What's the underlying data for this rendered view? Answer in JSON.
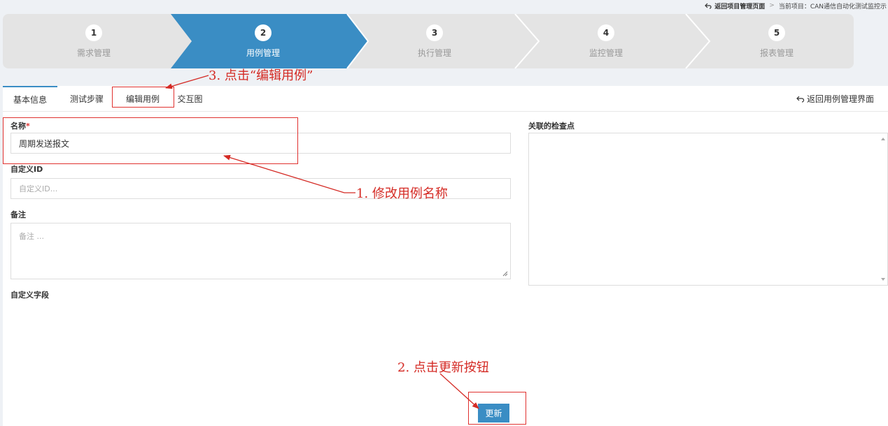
{
  "topbar": {
    "back_label": "返回项目管理页面",
    "separator": ">",
    "project_label": "当前项目：CAN通信自动化测试监控示"
  },
  "wizard": {
    "steps": [
      {
        "num": "1",
        "label": "需求管理",
        "active": false
      },
      {
        "num": "2",
        "label": "用例管理",
        "active": true
      },
      {
        "num": "3",
        "label": "执行管理",
        "active": false
      },
      {
        "num": "4",
        "label": "监控管理",
        "active": false
      },
      {
        "num": "5",
        "label": "报表管理",
        "active": false
      }
    ],
    "active_color": "#3a8dc4",
    "inactive_color": "#e4e4e4"
  },
  "tabs": [
    {
      "label": "基本信息",
      "active": true
    },
    {
      "label": "测试步骤",
      "active": false
    },
    {
      "label": "编辑用例",
      "active": false
    },
    {
      "label": "交互图",
      "active": false
    }
  ],
  "back_to_cases": "返回用例管理界面",
  "form": {
    "name_label": "名称",
    "required_mark": "*",
    "name_value": "周期发送报文",
    "custom_id_label": "自定义ID",
    "custom_id_placeholder": "自定义ID...",
    "remark_label": "备注",
    "remark_placeholder": "备注 ...",
    "custom_fields_label": "自定义字段",
    "linked_checkpoints_label": "关联的检查点",
    "update_button": "更新"
  },
  "annotations": {
    "step1": "1. 修改用例名称",
    "step2": "2. 点击更新按钮",
    "step3": "3. 点击“编辑用例”",
    "color": "#d42a24"
  },
  "icons": {
    "back": "return-arrow-icon",
    "resize": "resize-handle-icon"
  }
}
